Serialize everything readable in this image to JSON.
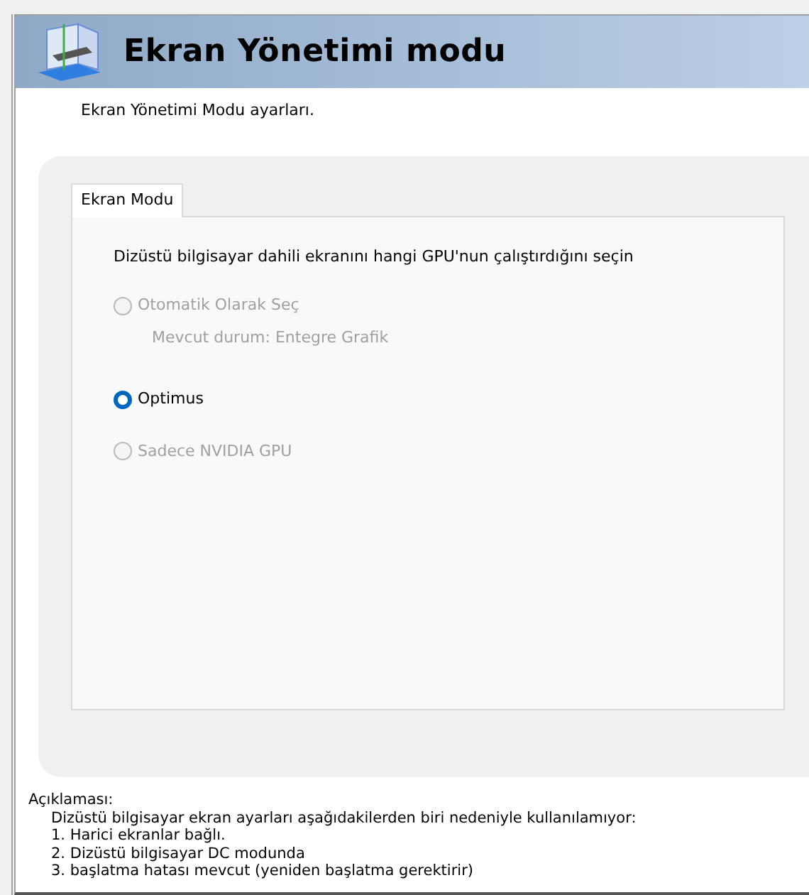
{
  "header": {
    "title": "Ekran Yönetimi modu",
    "subtitle": "Ekran Yönetimi Modu ayarları."
  },
  "tabs": [
    {
      "label": "Ekran Modu",
      "selected": true
    }
  ],
  "panel": {
    "prompt": "Dizüstü bilgisayar dahili ekranını hangi GPU'nun çalıştırdığını seçin",
    "options": [
      {
        "label": "Otomatik Olarak Seç",
        "selected": false,
        "disabled": true,
        "note": "Mevcut durum: Entegre Grafik"
      },
      {
        "label": "Optimus",
        "selected": true,
        "disabled": false
      },
      {
        "label": "Sadece NVIDIA GPU",
        "selected": false,
        "disabled": true
      }
    ]
  },
  "description": {
    "heading": "Açıklaması:",
    "lines": [
      "Dizüstü bilgisayar ekran ayarları aşağıdakilerden biri nedeniyle kullanılamıyor:",
      "1. Harici ekranlar bağlı.",
      "2. Dizüstü bilgisayar DC modunda",
      "3. başlatma hatası mevcut (yeniden başlatma gerektirir)"
    ]
  }
}
